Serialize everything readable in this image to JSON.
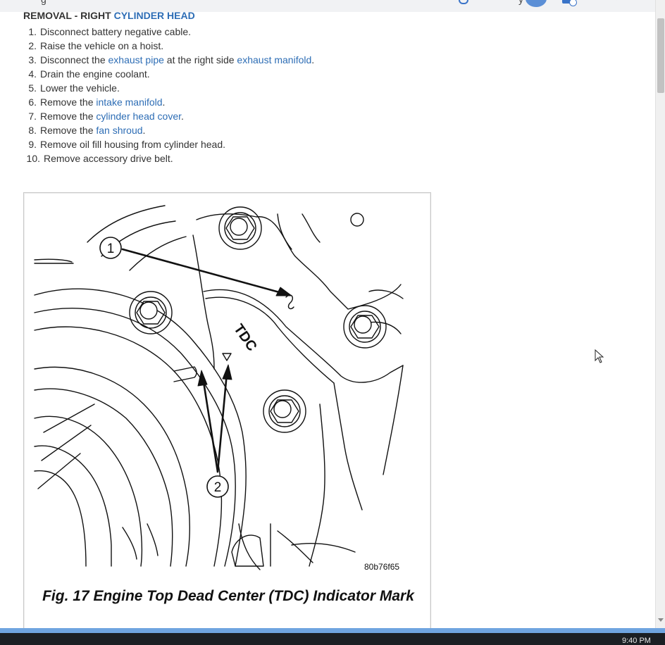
{
  "topbar": {
    "partial_title": "g",
    "partial_letter": "y"
  },
  "section": {
    "heading_prefix": "REMOVAL - RIGHT ",
    "heading_link": "CYLINDER HEAD"
  },
  "steps": [
    {
      "num": "1.",
      "parts": [
        {
          "t": "Disconnect battery negative cable."
        }
      ]
    },
    {
      "num": "2.",
      "parts": [
        {
          "t": "Raise the vehicle on a hoist."
        }
      ]
    },
    {
      "num": "3.",
      "parts": [
        {
          "t": "Disconnect the "
        },
        {
          "t": "exhaust pipe",
          "link": true
        },
        {
          "t": " at the right side "
        },
        {
          "t": "exhaust manifold",
          "link": true
        },
        {
          "t": "."
        }
      ]
    },
    {
      "num": "4.",
      "parts": [
        {
          "t": "Drain the engine coolant."
        }
      ]
    },
    {
      "num": "5.",
      "parts": [
        {
          "t": "Lower the vehicle."
        }
      ]
    },
    {
      "num": "6.",
      "parts": [
        {
          "t": "Remove the "
        },
        {
          "t": "intake manifold",
          "link": true
        },
        {
          "t": "."
        }
      ]
    },
    {
      "num": "7.",
      "parts": [
        {
          "t": "Remove the "
        },
        {
          "t": "cylinder head cover",
          "link": true
        },
        {
          "t": "."
        }
      ]
    },
    {
      "num": "8.",
      "parts": [
        {
          "t": "Remove the "
        },
        {
          "t": "fan shroud",
          "link": true
        },
        {
          "t": "."
        }
      ]
    },
    {
      "num": "9.",
      "parts": [
        {
          "t": "Remove oil fill housing from cylinder head."
        }
      ]
    },
    {
      "num": "10.",
      "parts": [
        {
          "t": "Remove accessory drive belt."
        }
      ]
    }
  ],
  "figure": {
    "callout_1": "1",
    "callout_2": "2",
    "tdc_label": "TDC",
    "code": "80b76f65",
    "caption": "Fig. 17 Engine Top Dead Center (TDC) Indicator Mark"
  },
  "taskbar": {
    "clock": "9:40 PM"
  },
  "colors": {
    "link": "#2d6db5",
    "accent": "#5b8fd6",
    "taskbar": "#1b1f24"
  }
}
